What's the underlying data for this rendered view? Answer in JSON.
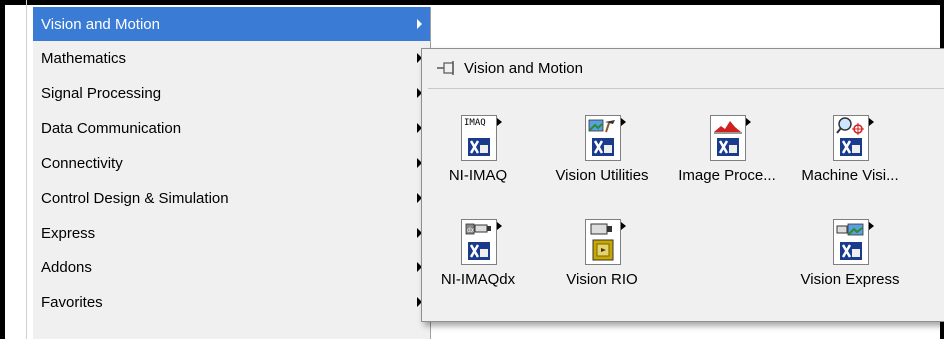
{
  "menu": {
    "items": [
      {
        "label": "Vision and Motion",
        "selected": true
      },
      {
        "label": "Mathematics"
      },
      {
        "label": "Signal Processing"
      },
      {
        "label": "Data Communication"
      },
      {
        "label": "Connectivity"
      },
      {
        "label": "Control Design & Simulation"
      },
      {
        "label": "Express"
      },
      {
        "label": "Addons"
      },
      {
        "label": "Favorites"
      }
    ]
  },
  "submenu": {
    "title": "Vision and Motion",
    "items": [
      {
        "label": "NI-IMAQ",
        "icon": "imaq-icon",
        "icon_text": "IMAQ"
      },
      {
        "label": "Vision Utilities",
        "icon": "vision-utilities-icon"
      },
      {
        "label": "Image Proce...",
        "icon": "image-processing-icon"
      },
      {
        "label": "Machine Visi...",
        "icon": "machine-vision-icon"
      },
      {
        "label": "NI-IMAQdx",
        "icon": "imaqdx-icon"
      },
      {
        "label": "Vision RIO",
        "icon": "vision-rio-icon"
      },
      {
        "label": "Vision Express",
        "icon": "vision-express-icon"
      }
    ]
  },
  "colors": {
    "selection": "#3a7bd5",
    "panel_bg": "#f0f0f0"
  }
}
